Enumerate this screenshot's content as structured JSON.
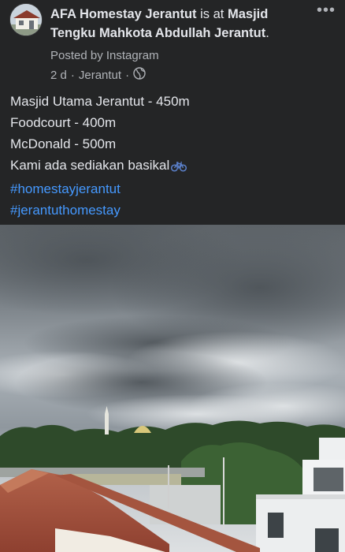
{
  "post": {
    "author": "AFA Homestay Jerantut",
    "connector": " is at ",
    "location": "Masjid Tengku Mahkota Abdullah Jerantut",
    "trailing": ".",
    "source": "Posted by Instagram",
    "time": "2 d",
    "dot1": "·",
    "place": "Jerantut",
    "dot2": "·",
    "privacy_icon": "globe-icon",
    "more_icon": "more-options-icon",
    "more_glyph": "•••"
  },
  "content": {
    "lines": [
      "Masjid Utama Jerantut - 450m",
      "Foodcourt - 400m",
      "McDonald - 500m",
      "Kami ada sediakan basikal"
    ],
    "bike_icon": "bicycle-icon",
    "hashtags": [
      "#homestayjerantut",
      "#jerantuthomestay"
    ]
  },
  "colors": {
    "background": "#242526",
    "text": "#e4e6eb",
    "secondary": "#b0b3b8",
    "hashtag": "#4599ff"
  }
}
